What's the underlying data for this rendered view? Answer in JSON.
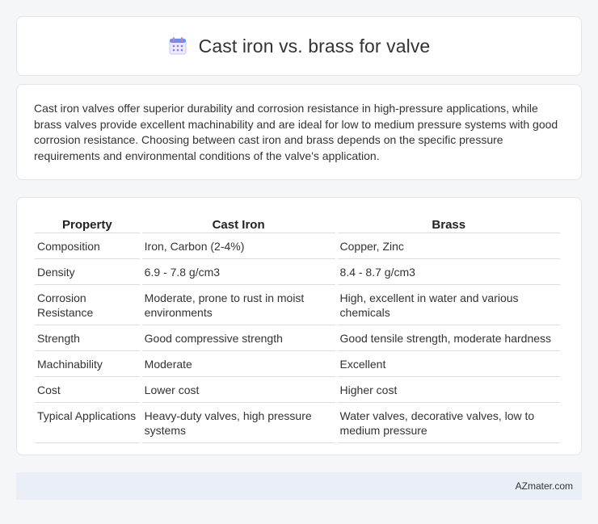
{
  "header": {
    "title": "Cast iron vs. brass for valve",
    "icon": "calendar-icon",
    "icon_color": "#7a8cf0"
  },
  "summary": {
    "text": "Cast iron valves offer superior durability and corrosion resistance in high-pressure applications, while brass valves provide excellent machinability and are ideal for low to medium pressure systems with good corrosion resistance. Choosing between cast iron and brass depends on the specific pressure requirements and environmental conditions of the valve's application."
  },
  "table": {
    "headers": [
      "Property",
      "Cast Iron",
      "Brass"
    ],
    "rows": [
      [
        "Composition",
        "Iron, Carbon (2-4%)",
        "Copper, Zinc"
      ],
      [
        "Density",
        "6.9 - 7.8 g/cm3",
        "8.4 - 8.7 g/cm3"
      ],
      [
        "Corrosion Resistance",
        "Moderate, prone to rust in moist environments",
        "High, excellent in water and various chemicals"
      ],
      [
        "Strength",
        "Good compressive strength",
        "Good tensile strength, moderate hardness"
      ],
      [
        "Machinability",
        "Moderate",
        "Excellent"
      ],
      [
        "Cost",
        "Lower cost",
        "Higher cost"
      ],
      [
        "Typical Applications",
        "Heavy-duty valves, high pressure systems",
        "Water valves, decorative valves, low to medium pressure"
      ]
    ]
  },
  "footer": {
    "text": "AZmater.com"
  }
}
